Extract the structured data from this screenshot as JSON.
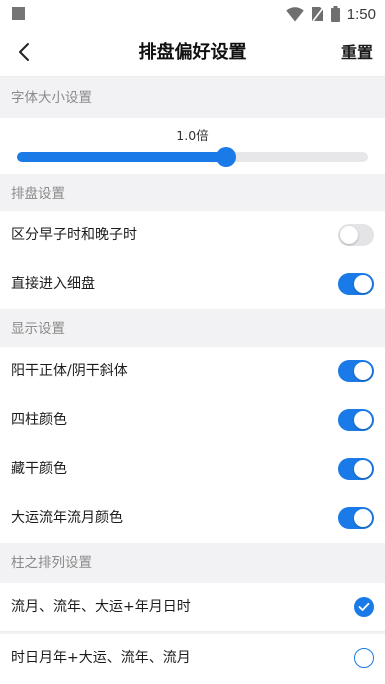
{
  "status_bar": {
    "time": "1:50"
  },
  "header": {
    "title": "排盘偏好设置",
    "reset_label": "重置"
  },
  "font_size": {
    "section_title": "字体大小设置",
    "value_label": "1.0倍",
    "slider_fraction": 0.595
  },
  "layout_settings": {
    "section_title": "排盘设置",
    "items": [
      {
        "label": "区分早子时和晚子时",
        "on": false
      },
      {
        "label": "直接进入细盘",
        "on": true
      }
    ]
  },
  "display_settings": {
    "section_title": "显示设置",
    "items": [
      {
        "label": "阳干正体/阴干斜体",
        "on": true
      },
      {
        "label": "四柱颜色",
        "on": true
      },
      {
        "label": "藏干颜色",
        "on": true
      },
      {
        "label": "大运流年流月颜色",
        "on": true
      }
    ]
  },
  "pillar_order": {
    "section_title": "柱之排列设置",
    "options": [
      {
        "label": "流月、流年、大运+年月日时",
        "selected": true
      },
      {
        "label": "时日月年+大运、流年、流月",
        "selected": false
      }
    ]
  },
  "colors": {
    "accent": "#1a7be8",
    "toggle_off": "#e4e4e6",
    "section_bg": "#f2f2f4"
  },
  "icons": {
    "back": "chevron-left-icon",
    "wifi": "wifi-icon",
    "sim": "no-sim-icon",
    "battery": "battery-icon",
    "check": "check-icon"
  }
}
